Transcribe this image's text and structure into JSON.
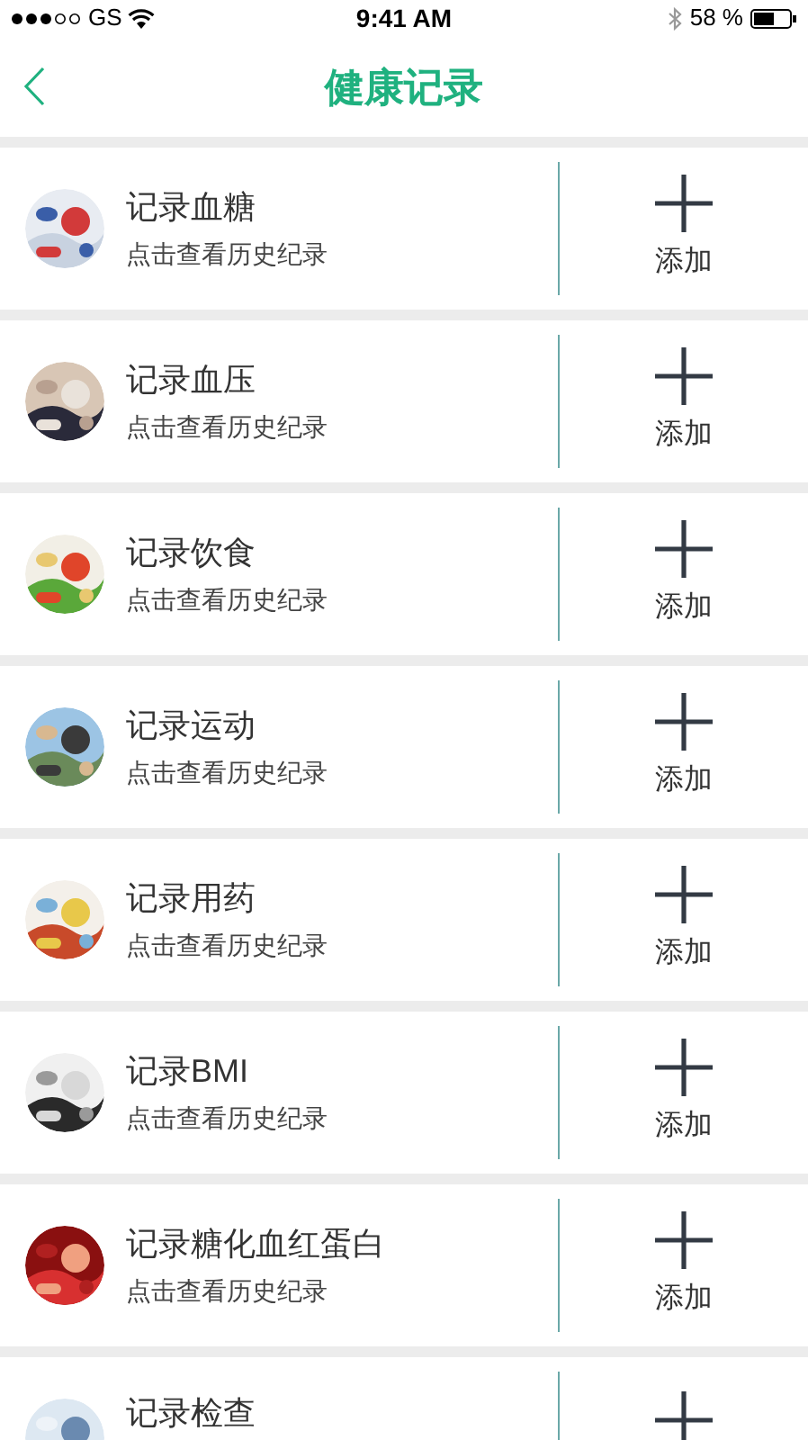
{
  "status_bar": {
    "carrier": "GS",
    "time": "9:41 AM",
    "battery_text": "58 %"
  },
  "nav": {
    "title": "健康记录"
  },
  "records": [
    {
      "title": "记录血糖",
      "subtitle": "点击查看历史纪录",
      "add_label": "添加"
    },
    {
      "title": "记录血压",
      "subtitle": "点击查看历史纪录",
      "add_label": "添加"
    },
    {
      "title": "记录饮食",
      "subtitle": "点击查看历史纪录",
      "add_label": "添加"
    },
    {
      "title": "记录运动",
      "subtitle": "点击查看历史纪录",
      "add_label": "添加"
    },
    {
      "title": "记录用药",
      "subtitle": "点击查看历史纪录",
      "add_label": "添加"
    },
    {
      "title": "记录BMI",
      "subtitle": "点击查看历史纪录",
      "add_label": "添加"
    },
    {
      "title": "记录糖化血红蛋白",
      "subtitle": "点击查看历史纪录",
      "add_label": "添加"
    },
    {
      "title": "记录检查"
    }
  ]
}
